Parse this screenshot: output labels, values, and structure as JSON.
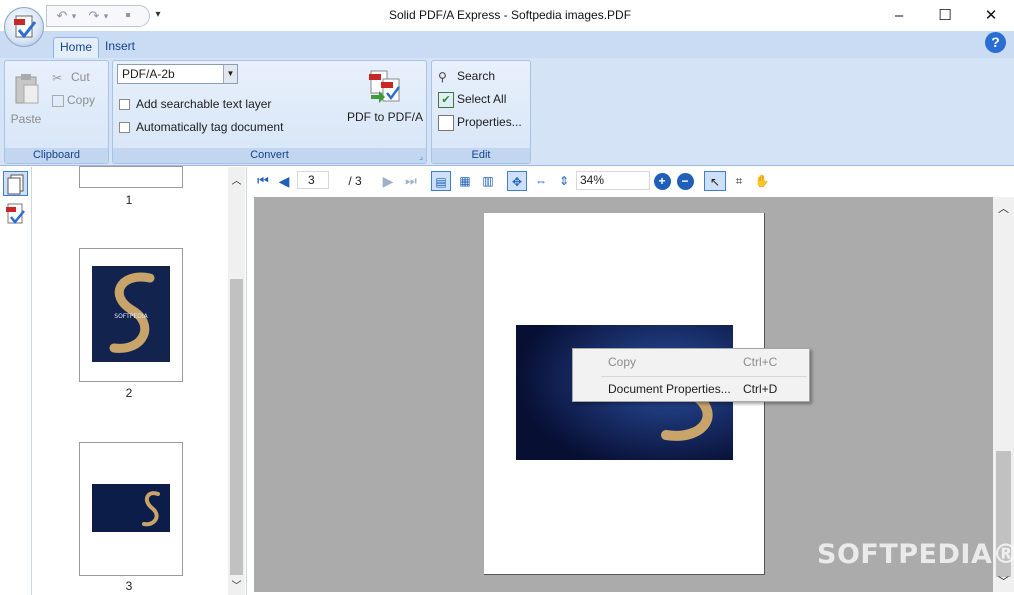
{
  "window": {
    "title": "Solid PDF/A Express - Softpedia images.PDF",
    "minimize": "–",
    "maximize": "☐",
    "close": "✕"
  },
  "qat": {
    "undo": "↶",
    "undo_drop": "▾",
    "redo": "↷",
    "redo_drop": "▾",
    "save": "▪",
    "menu": "▾"
  },
  "ribbon": {
    "tabs": [
      {
        "label": "Home",
        "active": true
      },
      {
        "label": "Insert",
        "active": false
      }
    ],
    "help": "?",
    "clipboard": {
      "label": "Clipboard",
      "paste": "Paste",
      "cut": "Cut",
      "copy": "Copy"
    },
    "convert": {
      "label": "Convert",
      "profile": "PDF/A-2b",
      "add_text_layer": "Add searchable text layer",
      "auto_tag": "Automatically tag document",
      "pdf_to_pdfa": "PDF to PDF/A"
    },
    "edit": {
      "label": "Edit",
      "search": "Search",
      "select_all": "Select All",
      "properties": "Properties..."
    }
  },
  "thumbnails": {
    "pages": [
      "1",
      "2",
      "3"
    ],
    "caption": "SOFTPEDIA"
  },
  "viewer": {
    "current_page": "3",
    "total_pages": "/ 3",
    "zoom": "34%"
  },
  "context_menu": {
    "items": [
      {
        "label": "Copy",
        "shortcut": "Ctrl+C",
        "enabled": false
      },
      {
        "label": "Document Properties...",
        "shortcut": "Ctrl+D",
        "enabled": true
      }
    ]
  },
  "watermark": "SOFTPEDIA®",
  "colors": {
    "ribbon": "#d4e3f5",
    "accent": "#1f5fb8",
    "doc_background": "#ababab"
  }
}
